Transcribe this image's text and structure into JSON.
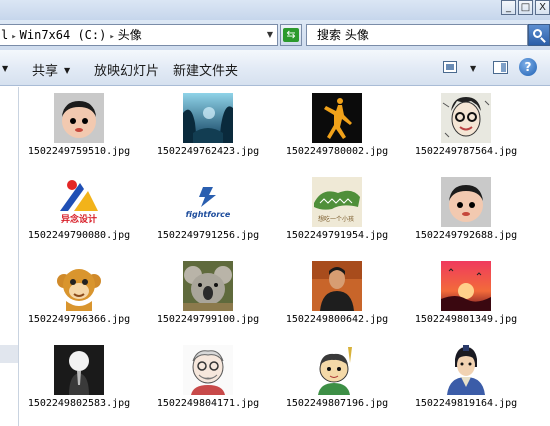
{
  "window": {
    "minimize": "_",
    "maximize": "□",
    "close": "X"
  },
  "address": {
    "prefix": "l",
    "segments": [
      "Win7x64 (C:)",
      "头像"
    ]
  },
  "search": {
    "placeholder": "搜索 头像"
  },
  "toolbar": {
    "share": "共享",
    "slideshow": "放映幻灯片",
    "new_folder": "新建文件夹",
    "help": "?"
  },
  "files": [
    {
      "name": "1502249759510.jpg",
      "icon": "cartoon-boy-avatar-icon"
    },
    {
      "name": "1502249762423.jpg",
      "icon": "fantasy-forest-scene-icon"
    },
    {
      "name": "1502249780002.jpg",
      "icon": "jumpman-logo-icon"
    },
    {
      "name": "1502249787564.jpg",
      "icon": "sketched-face-avatar-icon"
    },
    {
      "name": "1502249790080.jpg",
      "icon": "design-logo-icon"
    },
    {
      "name": "1502249791256.jpg",
      "icon": "fightforce-logo-icon"
    },
    {
      "name": "1502249791954.jpg",
      "icon": "crocodile-drawing-icon"
    },
    {
      "name": "1502249792688.jpg",
      "icon": "cartoon-boy-avatar-icon"
    },
    {
      "name": "1502249796366.jpg",
      "icon": "cartoon-monkey-icon"
    },
    {
      "name": "1502249799100.jpg",
      "icon": "koala-photo-icon"
    },
    {
      "name": "1502249800642.jpg",
      "icon": "man-portrait-icon"
    },
    {
      "name": "1502249801349.jpg",
      "icon": "sunset-scene-icon"
    },
    {
      "name": "1502249802583.jpg",
      "icon": "dark-silhouette-icon"
    },
    {
      "name": "1502249804171.jpg",
      "icon": "grandpa-drawing-icon"
    },
    {
      "name": "1502249807196.jpg",
      "icon": "cartoon-character-icon"
    },
    {
      "name": "1502249819164.jpg",
      "icon": "ancient-warrior-icon"
    }
  ]
}
